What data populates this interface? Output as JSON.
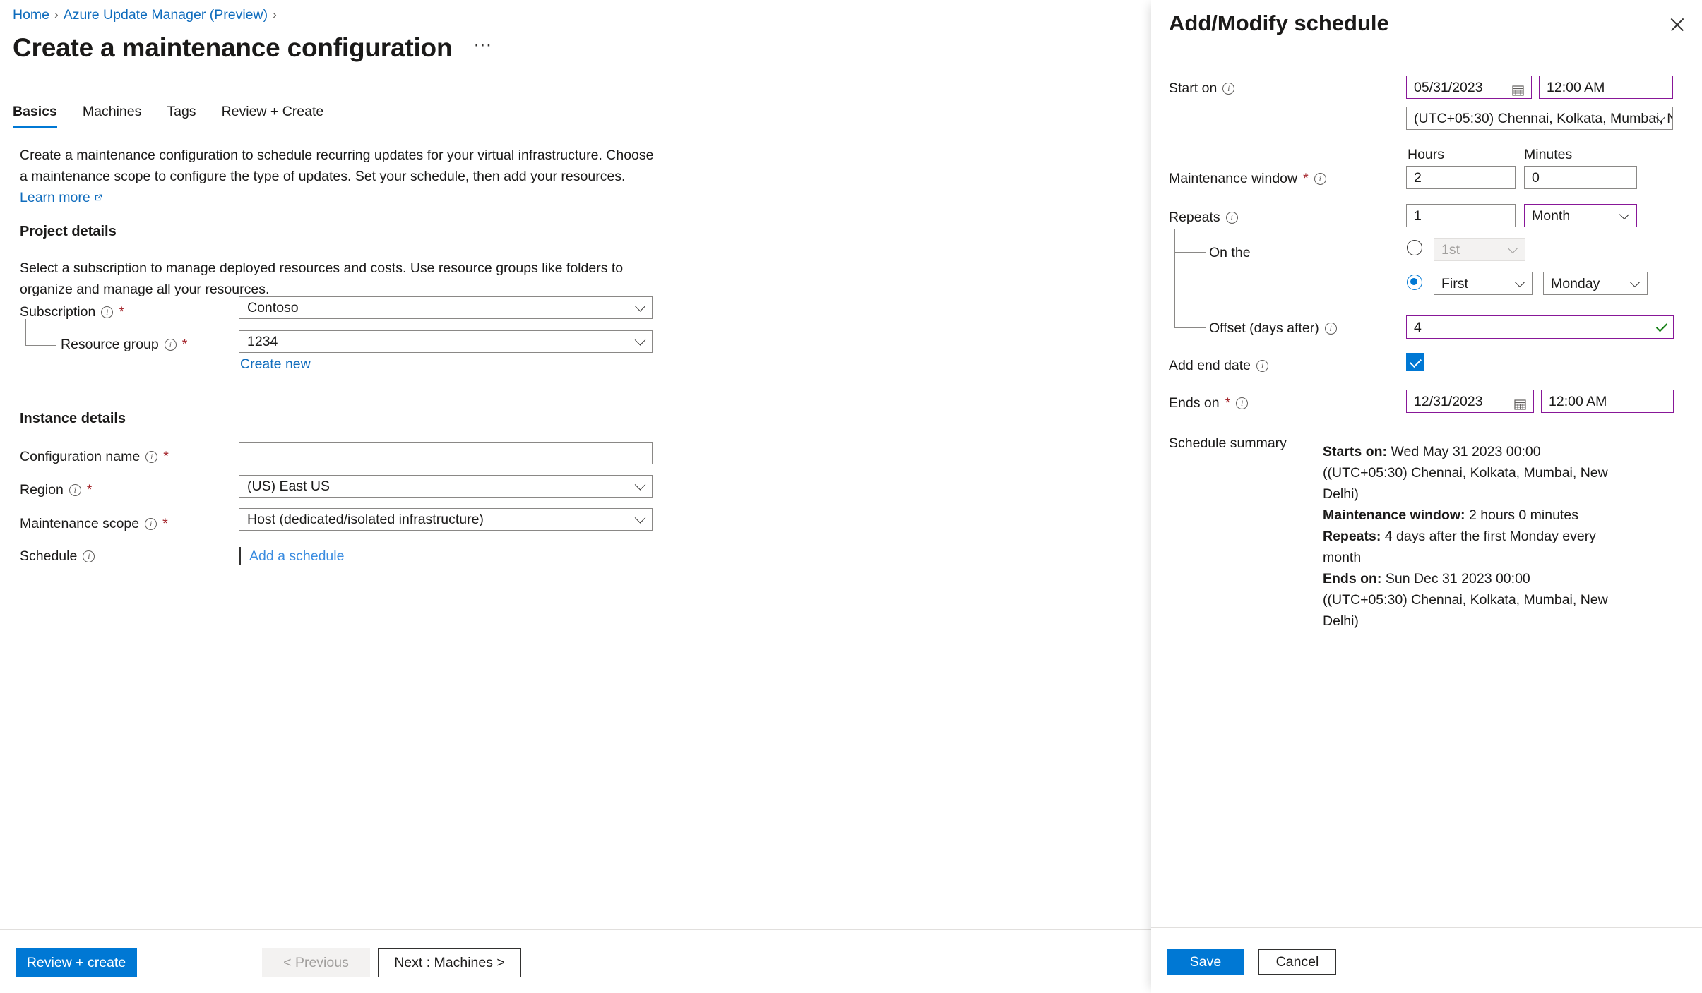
{
  "breadcrumb": {
    "items": [
      "Home",
      "Azure Update Manager (Preview)"
    ],
    "separator": "›"
  },
  "page": {
    "title": "Create a maintenance configuration",
    "more_actions": "···"
  },
  "tabs": [
    {
      "label": "Basics",
      "active": true
    },
    {
      "label": "Machines",
      "active": false
    },
    {
      "label": "Tags",
      "active": false
    },
    {
      "label": "Review + Create",
      "active": false
    }
  ],
  "intro": {
    "text": "Create a maintenance configuration to schedule recurring updates for your virtual infrastructure. Choose a maintenance scope to configure the type of updates. Set your schedule, then add your resources.",
    "link_label": "Learn more"
  },
  "project_details": {
    "heading": "Project details",
    "description": "Select a subscription to manage deployed resources and costs. Use resource groups like folders to organize and manage all your resources.",
    "subscription": {
      "label": "Subscription",
      "value": "Contoso",
      "required": "*"
    },
    "resource_group": {
      "label": "Resource group",
      "value": "1234",
      "required": "*",
      "create_new": "Create new"
    }
  },
  "instance_details": {
    "heading": "Instance details",
    "configuration_name": {
      "label": "Configuration name",
      "value": "",
      "placeholder": "",
      "required": "*"
    },
    "region": {
      "label": "Region",
      "value": "(US) East US",
      "required": "*"
    },
    "maintenance_scope": {
      "label": "Maintenance scope",
      "value": "Host (dedicated/isolated infrastructure)",
      "required": "*"
    },
    "schedule": {
      "label": "Schedule",
      "link_label": "Add a schedule"
    }
  },
  "footer": {
    "review_create": "Review + create",
    "previous": "< Previous",
    "next": "Next : Machines >"
  },
  "panel": {
    "title": "Add/Modify schedule",
    "start_on": {
      "label": "Start on",
      "date": "05/31/2023",
      "time": "12:00 AM",
      "timezone": "(UTC+05:30) Chennai, Kolkata, Mumbai, N..."
    },
    "maintenance_window": {
      "label": "Maintenance window",
      "required": "*",
      "hours_header": "Hours",
      "minutes_header": "Minutes",
      "hours": "2",
      "minutes": "0"
    },
    "repeats": {
      "label": "Repeats",
      "count": "1",
      "unit": "Month"
    },
    "on_the": {
      "label": "On the",
      "day_of_month_value": "1st",
      "day_of_month_selected": false,
      "ordinal_value": "First",
      "weekday_value": "Monday",
      "weekday_selected": true
    },
    "offset": {
      "label": "Offset (days after)",
      "value": "4"
    },
    "add_end_date": {
      "label": "Add end date",
      "checked": true
    },
    "ends_on": {
      "label": "Ends on",
      "required": "*",
      "date": "12/31/2023",
      "time": "12:00 AM"
    },
    "schedule_summary": {
      "label": "Schedule summary",
      "starts_on_label": "Starts on:",
      "starts_on_value": "Wed May 31 2023 00:00 ((UTC+05:30) Chennai, Kolkata, Mumbai, New Delhi)",
      "window_label": "Maintenance window:",
      "window_value": "2 hours 0 minutes",
      "repeats_label": "Repeats:",
      "repeats_value": "4 days after the first Monday every month",
      "ends_on_label": "Ends on:",
      "ends_on_value": "Sun Dec 31 2023 00:00 ((UTC+05:30) Chennai, Kolkata, Mumbai, New Delhi)"
    },
    "footer": {
      "save": "Save",
      "cancel": "Cancel"
    }
  },
  "colors": {
    "accent": "#0078d4",
    "link": "#0f6cbd",
    "required": "#a4262c",
    "modified_border": "#881798",
    "valid_check": "#107c10"
  }
}
